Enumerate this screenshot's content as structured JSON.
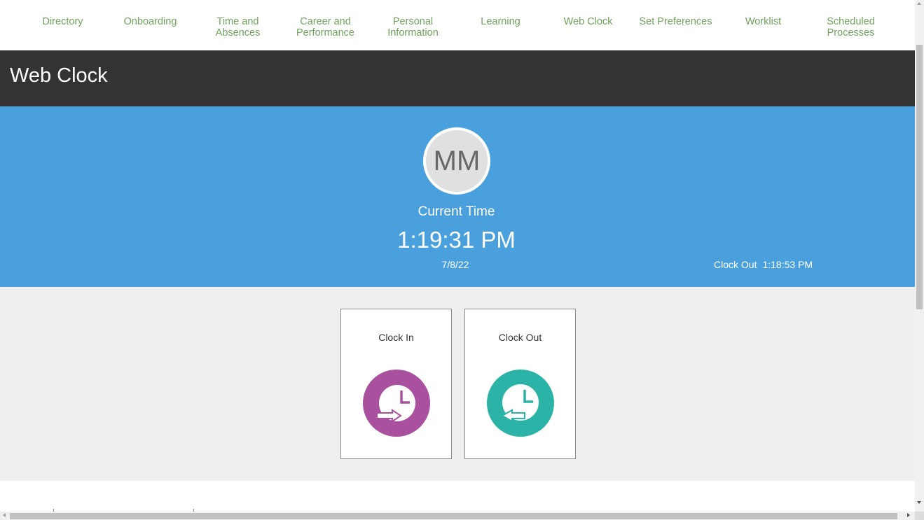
{
  "nav": {
    "items": [
      {
        "label": "Directory",
        "icon": "directory-icon"
      },
      {
        "label": "Onboarding",
        "icon": "onboarding-icon"
      },
      {
        "label": "Time and Absences",
        "icon": "time-absences-icon"
      },
      {
        "label": "Career and Performance",
        "icon": "career-icon"
      },
      {
        "label": "Personal Information",
        "icon": "personal-info-icon"
      },
      {
        "label": "Learning",
        "icon": "learning-icon"
      },
      {
        "label": "Web Clock",
        "icon": "web-clock-icon"
      },
      {
        "label": "Set Preferences",
        "icon": "preferences-icon"
      },
      {
        "label": "Worklist",
        "icon": "worklist-icon"
      },
      {
        "label": "Scheduled Processes",
        "icon": "scheduled-processes-icon"
      }
    ],
    "label_color": "#6fa35b",
    "icon_color": "#1e4f8a"
  },
  "page": {
    "title": "Web Clock"
  },
  "banner": {
    "avatar_initials": "MM",
    "current_label": "Current Time",
    "current_time": "1:19:31 PM",
    "date": "7/8/22",
    "last_event_label": "Clock Out",
    "last_event_time": "1:18:53 PM",
    "background": "#4aa0dc"
  },
  "actions": {
    "clock_in": {
      "label": "Clock In",
      "color": "#a9519f",
      "icon": "clock-in-icon"
    },
    "clock_out": {
      "label": "Clock Out",
      "color": "#2ab3a6",
      "icon": "clock-out-icon"
    }
  },
  "colors": {
    "title_bar": "#333333",
    "content_bg": "#efefef"
  }
}
